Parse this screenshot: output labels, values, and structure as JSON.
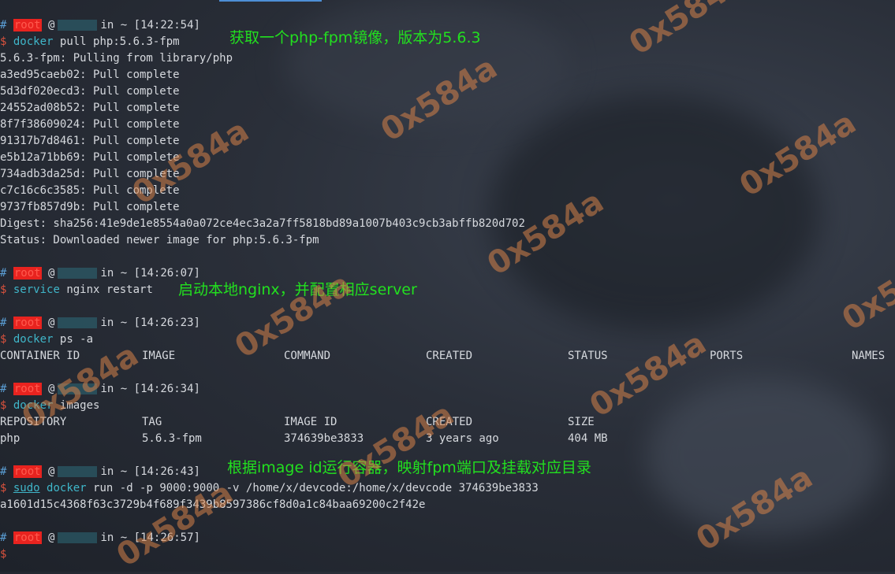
{
  "prompt": {
    "hash": "#",
    "user": "root",
    "at": "@",
    "in": "in",
    "tilde": "~",
    "dollar": "$"
  },
  "blocks": [
    {
      "time": "[14:22:54]",
      "cmd": "docker",
      "args": "pull php:5.6.3-fpm",
      "note": "获取一个php-fpm镜像，版本为5.6.3",
      "output": [
        "5.6.3-fpm: Pulling from library/php",
        "a3ed95caeb02: Pull complete",
        "5d3df020ecd3: Pull complete",
        "24552ad08b52: Pull complete",
        "8f7f38609024: Pull complete",
        "91317b7d8461: Pull complete",
        "e5b12a71bb69: Pull complete",
        "734adb3da25d: Pull complete",
        "c7c16c6c3585: Pull complete",
        "9737fb857d9b: Pull complete",
        "Digest: sha256:41e9de1e8554a0a072ce4ec3a2a7ff5818bd89a1007b403c9cb3abffb820d702",
        "Status: Downloaded newer image for php:5.6.3-fpm"
      ]
    },
    {
      "time": "[14:26:07]",
      "cmd": "service",
      "args": "nginx restart",
      "note": "启动本地nginx，并配置相应server"
    },
    {
      "time": "[14:26:23]",
      "cmd": "docker",
      "args": "ps -a",
      "headers": [
        "CONTAINER ID",
        "IMAGE",
        "COMMAND",
        "CREATED",
        "STATUS",
        "PORTS",
        "NAMES"
      ]
    },
    {
      "time": "[14:26:34]",
      "cmd": "docker",
      "args": "images",
      "headers": [
        "REPOSITORY",
        "TAG",
        "IMAGE ID",
        "CREATED",
        "SIZE"
      ],
      "row": [
        "php",
        "5.6.3-fpm",
        "374639be3833",
        "3 years ago",
        "404 MB"
      ]
    },
    {
      "time": "[14:26:43]",
      "sudo": "sudo",
      "cmd": "docker",
      "args": "run -d -p 9000:9000 -v /home/x/devcode:/home/x/devcode 374639be3833",
      "note": "根据image id运行容器，映射fpm端口及挂载对应目录",
      "output": [
        "a1601d15c4368f63c3729b4f689f3439b8597386cf8d0a1c84baa69200c2f42e"
      ]
    },
    {
      "time": "[14:26:57]"
    }
  ],
  "watermark": "0x584a",
  "colors": {
    "note": "#22e01f",
    "root_bg": "#e8231f",
    "cmd": "#3fb6c9",
    "hash": "#5b9fd6"
  }
}
